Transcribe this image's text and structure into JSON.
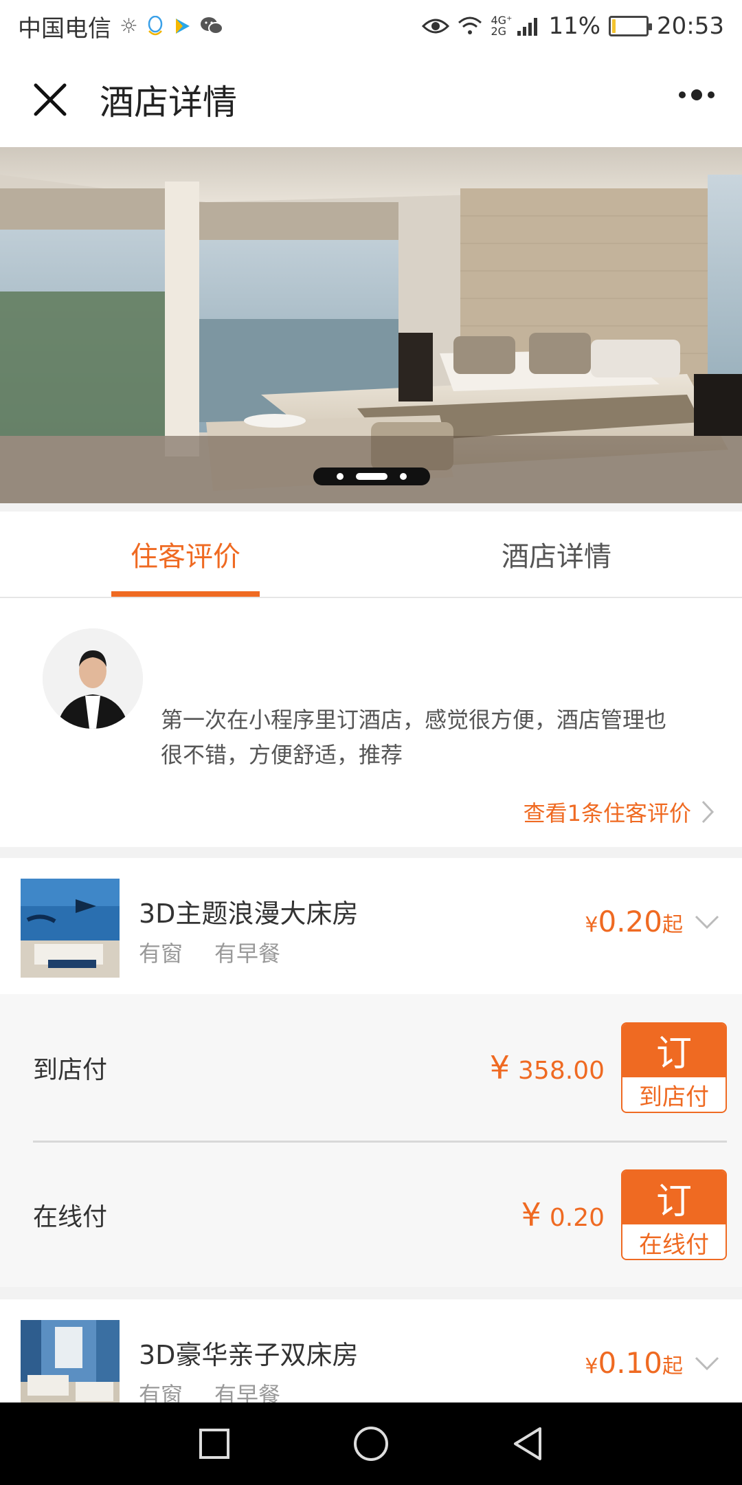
{
  "status_bar": {
    "carrier": "中国电信",
    "network": "4G⁺ 2G",
    "battery_percent": "11%",
    "battery_level": 0.11,
    "time": "20:53"
  },
  "nav": {
    "title": "酒店详情"
  },
  "banner": {
    "slides": 3,
    "active_index": 1
  },
  "tabs": [
    {
      "label": "住客评价",
      "active": true
    },
    {
      "label": "酒店详情",
      "active": false
    }
  ],
  "review": {
    "text": "第一次在小程序里订酒店，感觉很方便，酒店管理也很不错，方便舒适，推荐",
    "link_text": "查看1条住客评价"
  },
  "rooms": [
    {
      "name": "3D主题浪漫大床房",
      "tags": [
        "有窗",
        "有早餐"
      ],
      "price_symbol": "¥",
      "price": "0.20",
      "price_suffix": "起",
      "options": [
        {
          "label": "到店付",
          "symbol": "¥",
          "price": "358.00",
          "btn_top": "订",
          "btn_bottom": "到店付"
        },
        {
          "label": "在线付",
          "symbol": "¥",
          "price": "0.20",
          "btn_top": "订",
          "btn_bottom": "在线付"
        }
      ]
    },
    {
      "name": "3D豪华亲子双床房",
      "tags": [
        "有窗",
        "有早餐"
      ],
      "price_symbol": "¥",
      "price": "0.10",
      "price_suffix": "起"
    }
  ],
  "colors": {
    "accent": "#ef6a22",
    "text": "#333333",
    "muted": "#999999",
    "panel": "#f7f7f7"
  }
}
